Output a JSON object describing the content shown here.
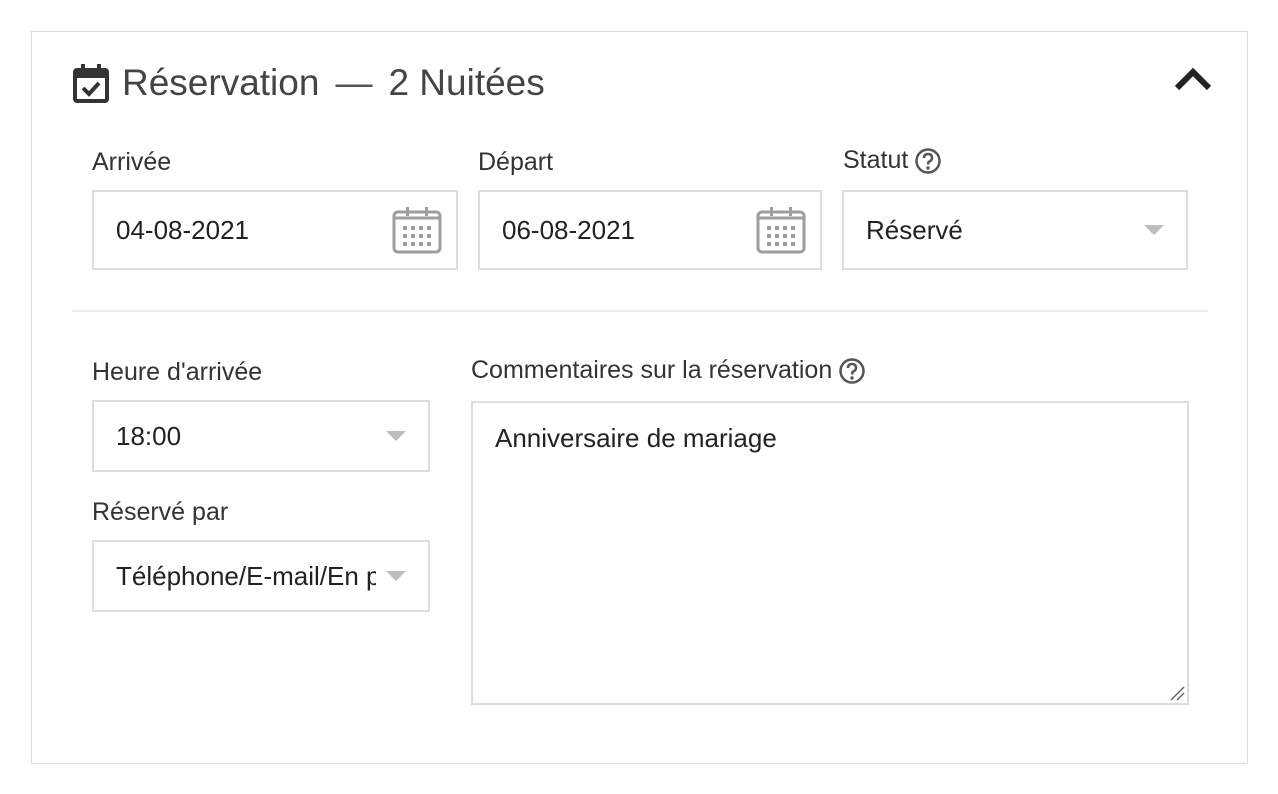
{
  "header": {
    "title": "Réservation",
    "separator": "—",
    "nights": "2 Nuitées",
    "icon": "calendar-check-icon",
    "collapse_icon": "chevron-up-icon"
  },
  "arrival": {
    "label": "Arrivée",
    "value": "04-08-2021",
    "icon": "calendar-icon"
  },
  "departure": {
    "label": "Départ",
    "value": "06-08-2021",
    "icon": "calendar-icon"
  },
  "status": {
    "label": "Statut",
    "value": "Réservé",
    "help_icon": "help-circle-icon"
  },
  "arrival_time": {
    "label": "Heure d'arrivée",
    "value": "18:00"
  },
  "booked_by": {
    "label": "Réservé par",
    "value": "Téléphone/E-mail/En personne"
  },
  "comments": {
    "label": "Commentaires sur la réservation",
    "value": "Anniversaire de mariage",
    "help_icon": "help-circle-icon"
  },
  "colors": {
    "border": "#dddddd",
    "text": "#333333",
    "icon_gray": "#9e9e9e",
    "caret": "#bdbdbd"
  }
}
